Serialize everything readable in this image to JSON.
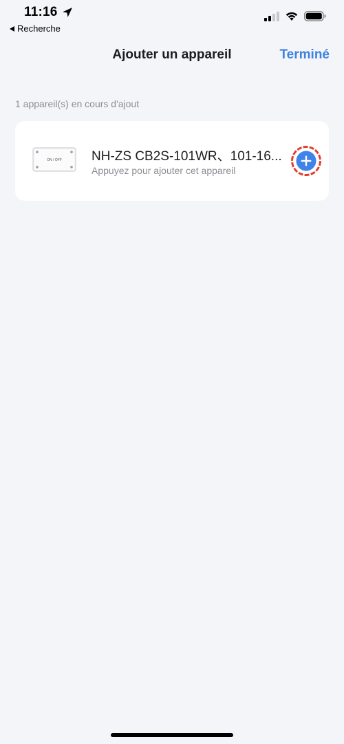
{
  "status_bar": {
    "time": "11:16",
    "back_app_label": "Recherche"
  },
  "nav": {
    "title": "Ajouter un appareil",
    "done_label": "Terminé"
  },
  "section": {
    "label": "1 appareil(s) en cours d'ajout"
  },
  "device": {
    "name": "NH-ZS CB2S-101WR、101-16...",
    "hint": "Appuyez pour ajouter cet appareil",
    "image_text": "ON / OFF"
  },
  "colors": {
    "accent": "#3D82E0",
    "add_button": "#3F82E8",
    "highlight_ring": "#E0402E",
    "background": "#F4F5F9",
    "card": "#FFFFFF"
  },
  "icons": {
    "location": "location-arrow-icon",
    "back": "back-triangle-icon",
    "signal": "cellular-signal-icon",
    "wifi": "wifi-icon",
    "battery": "battery-icon",
    "add": "plus-circle-icon"
  }
}
